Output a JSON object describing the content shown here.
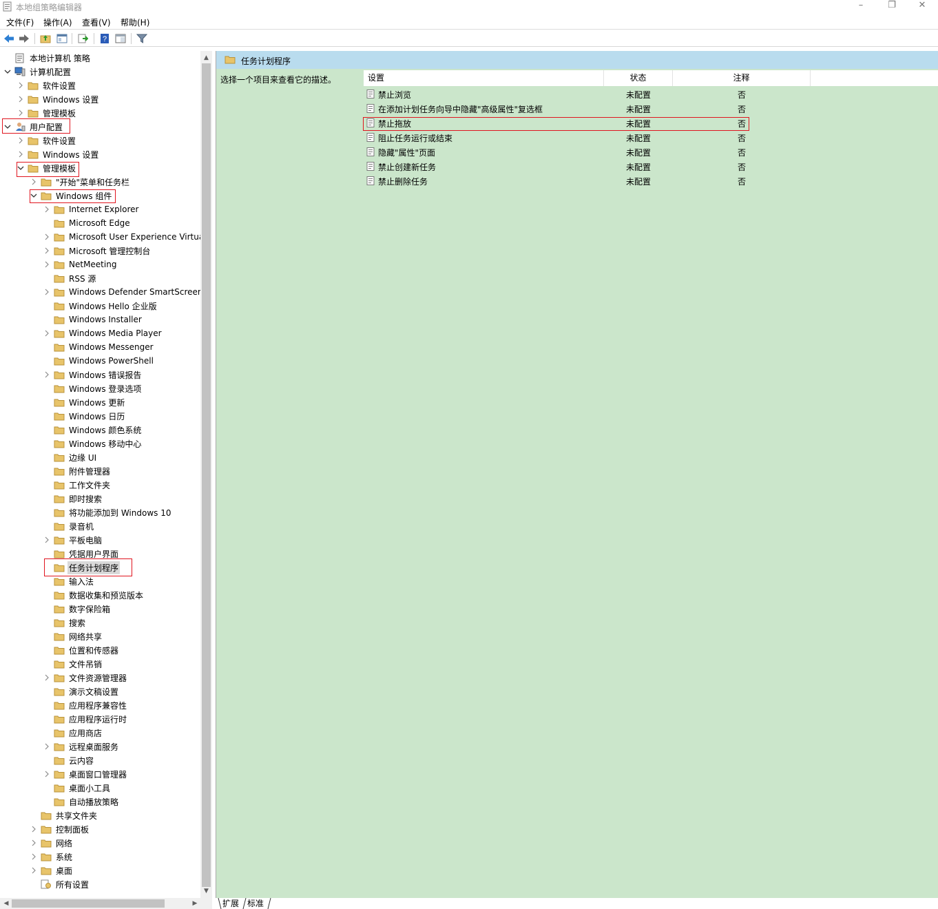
{
  "window": {
    "title": "本地组策略编辑器",
    "minimize": "–",
    "restore": "❐",
    "close": "✕"
  },
  "menu": [
    "文件(F)",
    "操作(A)",
    "查看(V)",
    "帮助(H)"
  ],
  "toolbar": [
    "back-icon",
    "forward-icon",
    "up-folder-icon",
    "show-hide-tree-icon",
    "export-list-icon",
    "help-icon",
    "properties-view-icon",
    "filter-icon"
  ],
  "tree": {
    "items": [
      {
        "label": "本地计算机 策略",
        "level": 0,
        "expander": "",
        "icon": "policy-icon",
        "selected": false
      },
      {
        "label": "计算机配置",
        "level": 0,
        "expander": "open",
        "icon": "computer-icon",
        "selected": false
      },
      {
        "label": "软件设置",
        "level": 1,
        "expander": "closed",
        "icon": "folder-icon",
        "selected": false
      },
      {
        "label": "Windows 设置",
        "level": 1,
        "expander": "closed",
        "icon": "folder-icon",
        "selected": false
      },
      {
        "label": "管理模板",
        "level": 1,
        "expander": "closed",
        "icon": "folder-icon",
        "selected": false
      },
      {
        "label": "用户配置",
        "level": 0,
        "expander": "open",
        "icon": "user-icon",
        "selected": false
      },
      {
        "label": "软件设置",
        "level": 1,
        "expander": "closed",
        "icon": "folder-icon",
        "selected": false
      },
      {
        "label": "Windows 设置",
        "level": 1,
        "expander": "closed",
        "icon": "folder-icon",
        "selected": false
      },
      {
        "label": "管理模板",
        "level": 1,
        "expander": "open",
        "icon": "folder-icon",
        "selected": false
      },
      {
        "label": "\"开始\"菜单和任务栏",
        "level": 2,
        "expander": "closed",
        "icon": "folder-icon",
        "selected": false
      },
      {
        "label": "Windows 组件",
        "level": 2,
        "expander": "open",
        "icon": "folder-icon",
        "selected": false
      },
      {
        "label": "Internet Explorer",
        "level": 3,
        "expander": "closed",
        "icon": "folder-icon",
        "selected": false
      },
      {
        "label": "Microsoft Edge",
        "level": 3,
        "expander": "",
        "icon": "folder-icon",
        "selected": false
      },
      {
        "label": "Microsoft User Experience Virtualization",
        "level": 3,
        "expander": "closed",
        "icon": "folder-icon",
        "selected": false
      },
      {
        "label": "Microsoft 管理控制台",
        "level": 3,
        "expander": "closed",
        "icon": "folder-icon",
        "selected": false
      },
      {
        "label": "NetMeeting",
        "level": 3,
        "expander": "closed",
        "icon": "folder-icon",
        "selected": false
      },
      {
        "label": "RSS 源",
        "level": 3,
        "expander": "",
        "icon": "folder-icon",
        "selected": false
      },
      {
        "label": "Windows Defender SmartScreen",
        "level": 3,
        "expander": "closed",
        "icon": "folder-icon",
        "selected": false
      },
      {
        "label": "Windows Hello 企业版",
        "level": 3,
        "expander": "",
        "icon": "folder-icon",
        "selected": false
      },
      {
        "label": "Windows Installer",
        "level": 3,
        "expander": "",
        "icon": "folder-icon",
        "selected": false
      },
      {
        "label": "Windows Media Player",
        "level": 3,
        "expander": "closed",
        "icon": "folder-icon",
        "selected": false
      },
      {
        "label": "Windows Messenger",
        "level": 3,
        "expander": "",
        "icon": "folder-icon",
        "selected": false
      },
      {
        "label": "Windows PowerShell",
        "level": 3,
        "expander": "",
        "icon": "folder-icon",
        "selected": false
      },
      {
        "label": "Windows 错误报告",
        "level": 3,
        "expander": "closed",
        "icon": "folder-icon",
        "selected": false
      },
      {
        "label": "Windows 登录选项",
        "level": 3,
        "expander": "",
        "icon": "folder-icon",
        "selected": false
      },
      {
        "label": "Windows 更新",
        "level": 3,
        "expander": "",
        "icon": "folder-icon",
        "selected": false
      },
      {
        "label": "Windows 日历",
        "level": 3,
        "expander": "",
        "icon": "folder-icon",
        "selected": false
      },
      {
        "label": "Windows 颜色系统",
        "level": 3,
        "expander": "",
        "icon": "folder-icon",
        "selected": false
      },
      {
        "label": "Windows 移动中心",
        "level": 3,
        "expander": "",
        "icon": "folder-icon",
        "selected": false
      },
      {
        "label": "边缘 UI",
        "level": 3,
        "expander": "",
        "icon": "folder-icon",
        "selected": false
      },
      {
        "label": "附件管理器",
        "level": 3,
        "expander": "",
        "icon": "folder-icon",
        "selected": false
      },
      {
        "label": "工作文件夹",
        "level": 3,
        "expander": "",
        "icon": "folder-icon",
        "selected": false
      },
      {
        "label": "即时搜索",
        "level": 3,
        "expander": "",
        "icon": "folder-icon",
        "selected": false
      },
      {
        "label": "将功能添加到 Windows 10",
        "level": 3,
        "expander": "",
        "icon": "folder-icon",
        "selected": false
      },
      {
        "label": "录音机",
        "level": 3,
        "expander": "",
        "icon": "folder-icon",
        "selected": false
      },
      {
        "label": "平板电脑",
        "level": 3,
        "expander": "closed",
        "icon": "folder-icon",
        "selected": false
      },
      {
        "label": "凭据用户界面",
        "level": 3,
        "expander": "",
        "icon": "folder-icon",
        "selected": false
      },
      {
        "label": "任务计划程序",
        "level": 3,
        "expander": "",
        "icon": "folder-icon",
        "selected": true
      },
      {
        "label": "输入法",
        "level": 3,
        "expander": "",
        "icon": "folder-icon",
        "selected": false
      },
      {
        "label": "数据收集和预览版本",
        "level": 3,
        "expander": "",
        "icon": "folder-icon",
        "selected": false
      },
      {
        "label": "数字保险箱",
        "level": 3,
        "expander": "",
        "icon": "folder-icon",
        "selected": false
      },
      {
        "label": "搜索",
        "level": 3,
        "expander": "",
        "icon": "folder-icon",
        "selected": false
      },
      {
        "label": "网络共享",
        "level": 3,
        "expander": "",
        "icon": "folder-icon",
        "selected": false
      },
      {
        "label": "位置和传感器",
        "level": 3,
        "expander": "",
        "icon": "folder-icon",
        "selected": false
      },
      {
        "label": "文件吊销",
        "level": 3,
        "expander": "",
        "icon": "folder-icon",
        "selected": false
      },
      {
        "label": "文件资源管理器",
        "level": 3,
        "expander": "closed",
        "icon": "folder-icon",
        "selected": false
      },
      {
        "label": "演示文稿设置",
        "level": 3,
        "expander": "",
        "icon": "folder-icon",
        "selected": false
      },
      {
        "label": "应用程序兼容性",
        "level": 3,
        "expander": "",
        "icon": "folder-icon",
        "selected": false
      },
      {
        "label": "应用程序运行时",
        "level": 3,
        "expander": "",
        "icon": "folder-icon",
        "selected": false
      },
      {
        "label": "应用商店",
        "level": 3,
        "expander": "",
        "icon": "folder-icon",
        "selected": false
      },
      {
        "label": "远程桌面服务",
        "level": 3,
        "expander": "closed",
        "icon": "folder-icon",
        "selected": false
      },
      {
        "label": "云内容",
        "level": 3,
        "expander": "",
        "icon": "folder-icon",
        "selected": false
      },
      {
        "label": "桌面窗口管理器",
        "level": 3,
        "expander": "closed",
        "icon": "folder-icon",
        "selected": false
      },
      {
        "label": "桌面小工具",
        "level": 3,
        "expander": "",
        "icon": "folder-icon",
        "selected": false
      },
      {
        "label": "自动播放策略",
        "level": 3,
        "expander": "",
        "icon": "folder-icon",
        "selected": false
      },
      {
        "label": "共享文件夹",
        "level": 2,
        "expander": "",
        "icon": "folder-icon",
        "selected": false
      },
      {
        "label": "控制面板",
        "level": 2,
        "expander": "closed",
        "icon": "folder-icon",
        "selected": false
      },
      {
        "label": "网络",
        "level": 2,
        "expander": "closed",
        "icon": "folder-icon",
        "selected": false
      },
      {
        "label": "系统",
        "level": 2,
        "expander": "closed",
        "icon": "folder-icon",
        "selected": false
      },
      {
        "label": "桌面",
        "level": 2,
        "expander": "closed",
        "icon": "folder-icon",
        "selected": false
      },
      {
        "label": "所有设置",
        "level": 2,
        "expander": "",
        "icon": "all-settings-icon",
        "selected": false
      }
    ]
  },
  "right": {
    "title": "任务计划程序",
    "description": "选择一个项目来查看它的描述。",
    "columns": [
      "设置",
      "状态",
      "注释"
    ],
    "rows": [
      {
        "setting": "禁止浏览",
        "state": "未配置",
        "comment": "否",
        "highlighted": false
      },
      {
        "setting": "在添加计划任务向导中隐藏\"高级属性\"复选框",
        "state": "未配置",
        "comment": "否",
        "highlighted": false
      },
      {
        "setting": "禁止拖放",
        "state": "未配置",
        "comment": "否",
        "highlighted": true
      },
      {
        "setting": "阻止任务运行或结束",
        "state": "未配置",
        "comment": "否",
        "highlighted": false
      },
      {
        "setting": "隐藏\"属性\"页面",
        "state": "未配置",
        "comment": "否",
        "highlighted": false
      },
      {
        "setting": "禁止创建新任务",
        "state": "未配置",
        "comment": "否",
        "highlighted": false
      },
      {
        "setting": "禁止删除任务",
        "state": "未配置",
        "comment": "否",
        "highlighted": false
      }
    ]
  },
  "tabs": [
    "扩展",
    "标准"
  ],
  "colors": {
    "highlight_box": "#e0141e",
    "right_pane_bg": "#cbe6cb",
    "header_bg": "#b9dcee",
    "folder": "#e8c46a"
  }
}
